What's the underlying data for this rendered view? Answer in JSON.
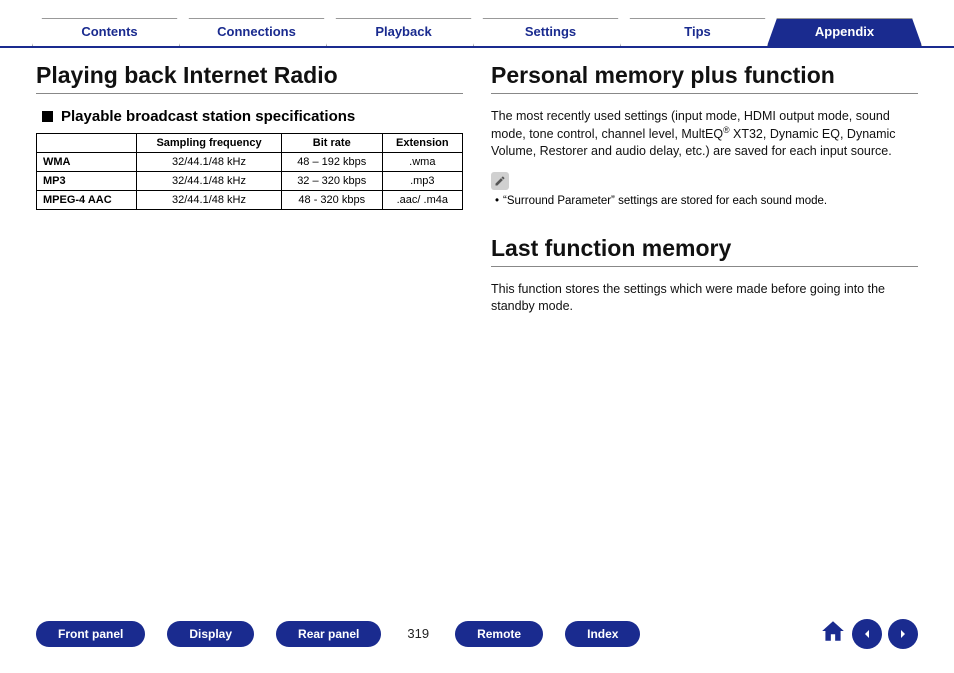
{
  "tabs": {
    "items": [
      "Contents",
      "Connections",
      "Playback",
      "Settings",
      "Tips",
      "Appendix"
    ],
    "activeIndex": 5
  },
  "left": {
    "h1": "Playing back Internet Radio",
    "subhead": "Playable broadcast station specifications",
    "table": {
      "headers": [
        "",
        "Sampling frequency",
        "Bit rate",
        "Extension"
      ],
      "rows": [
        {
          "name": "WMA",
          "sf": "32/44.1/48 kHz",
          "br": "48 – 192 kbps",
          "ext": ".wma"
        },
        {
          "name": "MP3",
          "sf": "32/44.1/48 kHz",
          "br": "32 – 320 kbps",
          "ext": ".mp3"
        },
        {
          "name": "MPEG-4 AAC",
          "sf": "32/44.1/48 kHz",
          "br": "48 - 320 kbps",
          "ext": ".aac/ .m4a"
        }
      ]
    }
  },
  "right": {
    "section1": {
      "h1": "Personal memory plus function",
      "para_a": "The most recently used settings (input mode, HDMI output mode, sound mode, tone control, channel level, MultEQ",
      "para_b": " XT32, Dynamic EQ, Dynamic Volume, Restorer and audio delay, etc.) are saved for each input source.",
      "note": "“Surround Parameter” settings are stored for each sound mode."
    },
    "section2": {
      "h1": "Last function memory",
      "para": "This function stores the settings which were made before going into the standby mode."
    }
  },
  "footer": {
    "buttons": [
      "Front panel",
      "Display",
      "Rear panel"
    ],
    "page": "319",
    "buttons2": [
      "Remote",
      "Index"
    ]
  }
}
